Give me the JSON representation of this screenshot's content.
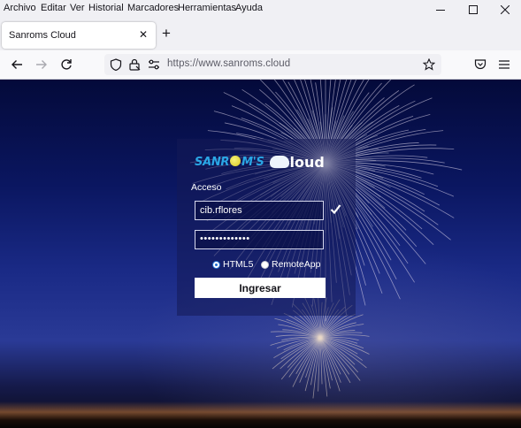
{
  "menu": [
    "Archivo",
    "Editar",
    "Ver",
    "Historial",
    "Marcadores",
    "Herramientas",
    "Ayuda"
  ],
  "tab": {
    "title": "Sanroms Cloud",
    "close_glyph": "✕"
  },
  "new_tab_glyph": "+",
  "address_bar": {
    "url": "https://www.sanroms.cloud"
  },
  "login": {
    "logo_sanroms": {
      "pre": "SANR",
      "post": "M'S"
    },
    "logo_cloud": "loud",
    "section_label": "Acceso",
    "username": "cib.rflores",
    "password_mask": "•••••••••••••",
    "options": [
      {
        "label": "HTML5",
        "selected": true
      },
      {
        "label": "RemoteApp",
        "selected": false
      }
    ],
    "submit_label": "Ingresar"
  },
  "colors": {
    "accent_blue": "#2aa7e6",
    "logo_yellow": "#f7f27a",
    "sky_top": "#040a3a",
    "sky_mid": "#1a2a86"
  }
}
